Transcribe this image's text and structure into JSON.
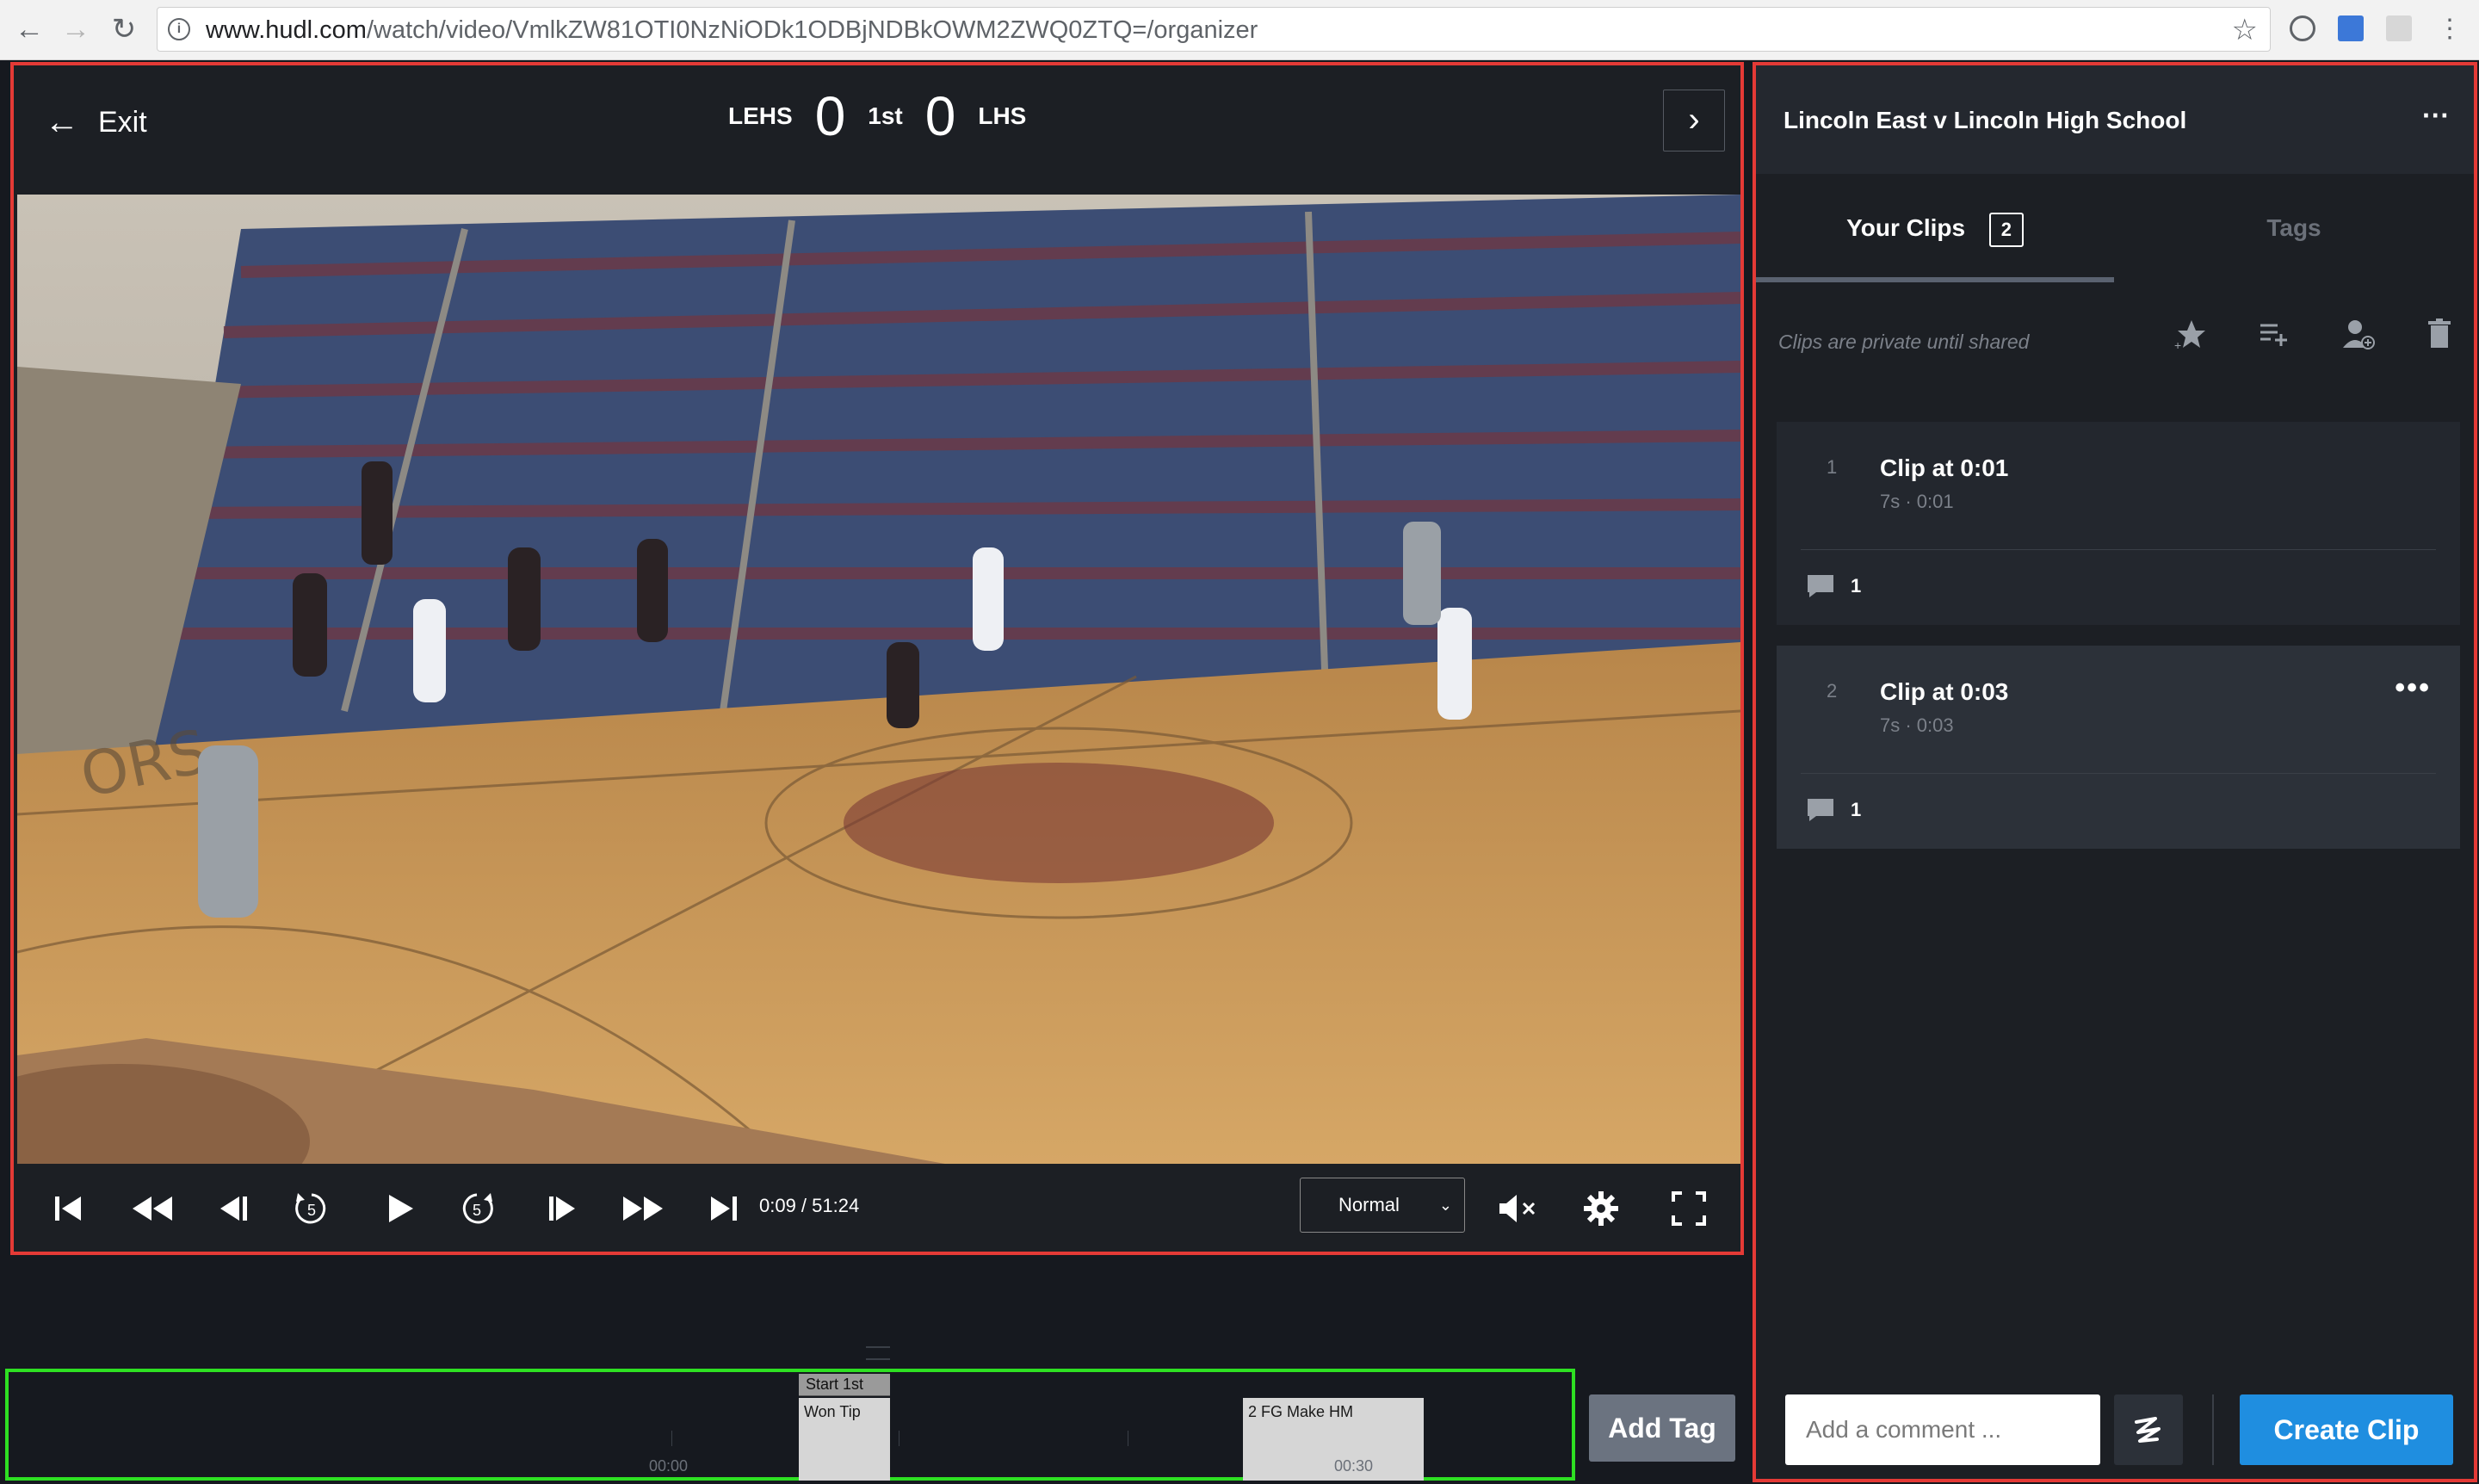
{
  "browser": {
    "url_host": "www.hudl.com",
    "url_path": "/watch/video/VmlkZW81OTI0NzNiODk1ODBjNDBkOWM2ZWQ0ZTQ=/organizer"
  },
  "player": {
    "exit_label": "Exit",
    "home_team": "LEHS",
    "home_score": "0",
    "period": "1st",
    "away_score": "0",
    "away_team": "LHS",
    "timecode": "0:09 / 51:24",
    "speed": "Normal",
    "skip_back_seconds": "5",
    "skip_forward_seconds": "5"
  },
  "timeline": {
    "times": [
      "00:00",
      "00:30"
    ],
    "tag_head": "Start 1st",
    "tag1": "Won Tip",
    "tag2": "2 FG Make HM",
    "add_tag_label": "Add Tag"
  },
  "sidebar": {
    "title": "Lincoln East v Lincoln High School",
    "tab_clips": "Your Clips",
    "clips_count": "2",
    "tab_tags": "Tags",
    "privacy_note": "Clips are private until shared",
    "clips": [
      {
        "index": "1",
        "name": "Clip at 0:01",
        "meta": "7s · 0:01",
        "comments": "1"
      },
      {
        "index": "2",
        "name": "Clip at 0:03",
        "meta": "7s · 0:03",
        "comments": "1"
      }
    ],
    "comment_placeholder": "Add a comment ...",
    "create_clip_label": "Create Clip"
  },
  "colors": {
    "accent_blue": "#1f8ee0",
    "highlight_red": "#e43a36",
    "highlight_green": "#2ee022"
  }
}
